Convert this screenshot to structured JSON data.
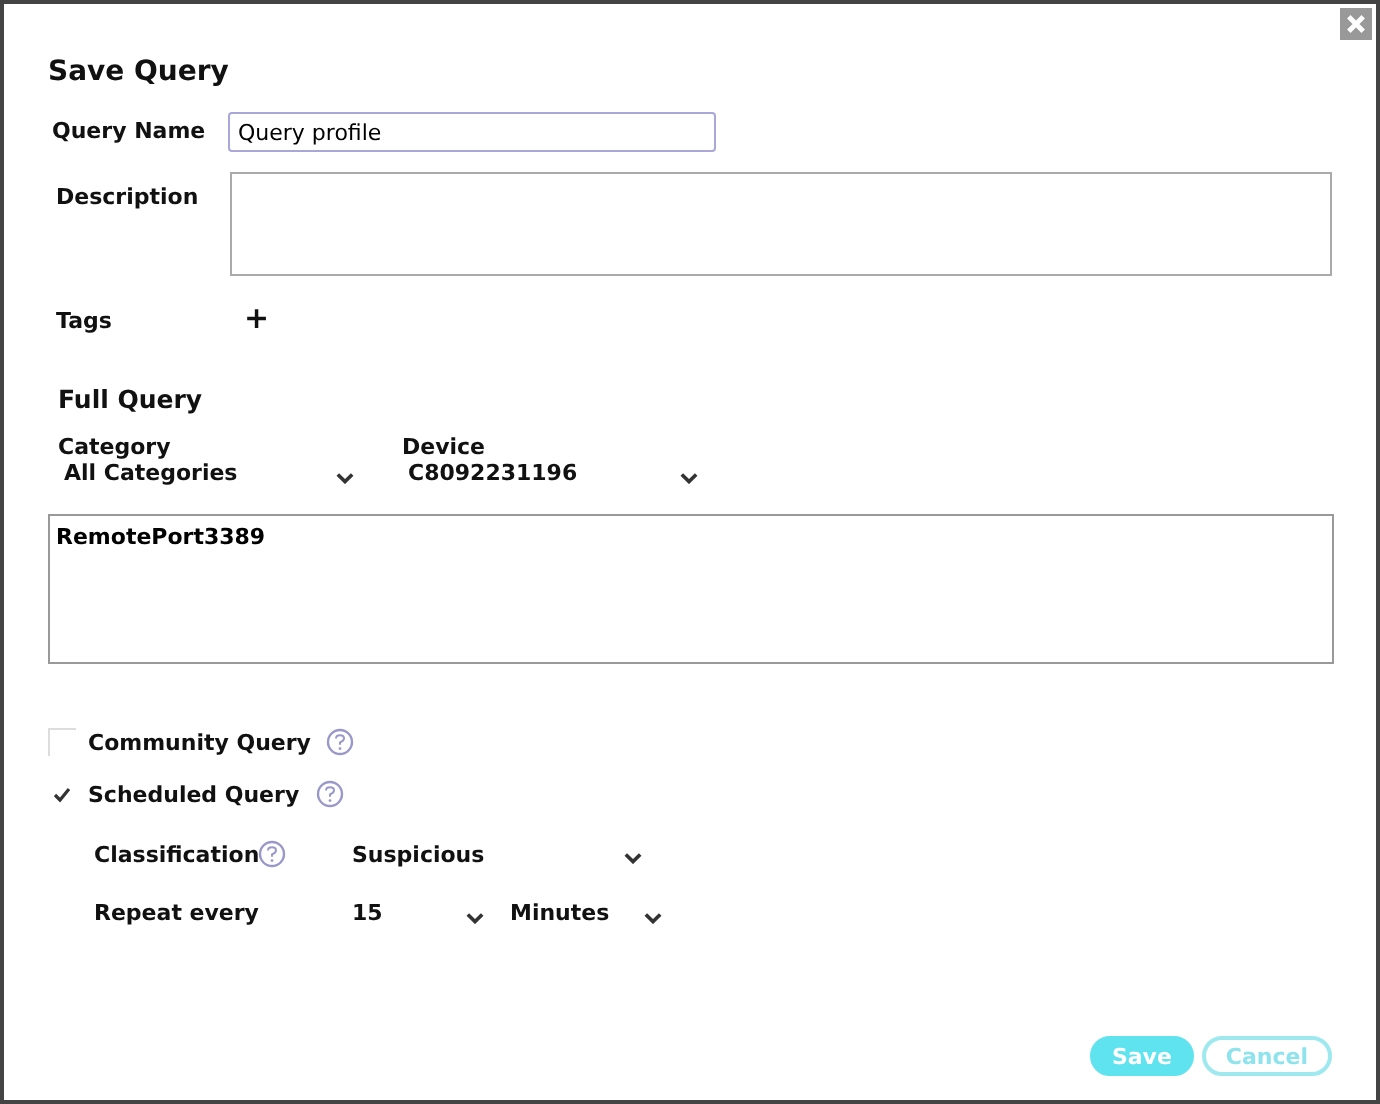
{
  "title": "Save Query",
  "query_name": {
    "label": "Query Name",
    "value": "Query profile"
  },
  "description": {
    "label": "Description"
  },
  "tags": {
    "label": "Tags",
    "add": "+"
  },
  "full_query": {
    "heading": "Full Query",
    "category": {
      "label": "Category",
      "value": "All Categories"
    },
    "device": {
      "label": "Device",
      "value": "C8092231196"
    },
    "text": "RemotePort3389"
  },
  "options": [
    {
      "label": "Community Query",
      "checked": false
    },
    {
      "label": "Scheduled Query",
      "checked": true
    }
  ],
  "classification": {
    "label": "Classification",
    "value": "Suspicious"
  },
  "repeat": {
    "label": "Repeat every",
    "value": "15",
    "unit": "Minutes"
  },
  "buttons": [
    {
      "label": "Save",
      "kind": "primary"
    },
    {
      "label": "Cancel",
      "kind": "secondary"
    }
  ]
}
